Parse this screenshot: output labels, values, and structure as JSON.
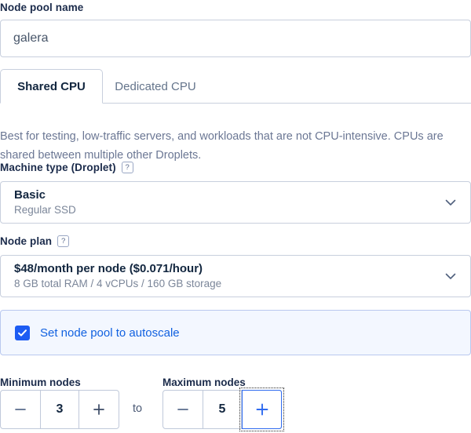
{
  "node_pool_name": {
    "label": "Node pool name",
    "value": "galera",
    "placeholder": "Enter node pool name"
  },
  "tabs": [
    {
      "label": "Shared CPU",
      "active": true
    },
    {
      "label": "Dedicated CPU",
      "active": false
    }
  ],
  "tab_description": "Best for testing, low-traffic servers, and workloads that are not CPU-intensive. CPUs are shared between multiple other Droplets.",
  "machine_type": {
    "label": "Machine type (Droplet)",
    "help_icon": "question-mark-icon",
    "help_glyph": "?",
    "selected_title": "Basic",
    "selected_subtitle": "Regular SSD",
    "chevron_icon": "chevron-down-icon"
  },
  "node_plan": {
    "label": "Node plan",
    "help_icon": "question-mark-icon",
    "help_glyph": "?",
    "selected_title": "$48/month per node ($0.071/hour)",
    "selected_subtitle": "8 GB total RAM / 4 vCPUs / 160 GB storage",
    "chevron_icon": "chevron-down-icon"
  },
  "autoscale": {
    "label": "Set node pool to autoscale",
    "checked": true,
    "checkbox_icon": "checkmark-icon"
  },
  "node_range": {
    "min_label": "Minimum nodes",
    "max_label": "Maximum nodes",
    "separator": "to",
    "min_value": "3",
    "max_value": "5",
    "decrement_glyph": "−",
    "increment_glyph": "+",
    "decrement_icon": "minus-icon",
    "increment_icon": "plus-icon",
    "focused_control": "max-nodes-increment"
  },
  "colors": {
    "accent_blue": "#1d5cf3",
    "link_blue": "#1161e0",
    "panel_bg": "#f3f7ff",
    "panel_border": "#b9c8ef",
    "border": "#c8cfdd",
    "label_text": "#1b2b4b",
    "muted_text": "#6b7794"
  }
}
